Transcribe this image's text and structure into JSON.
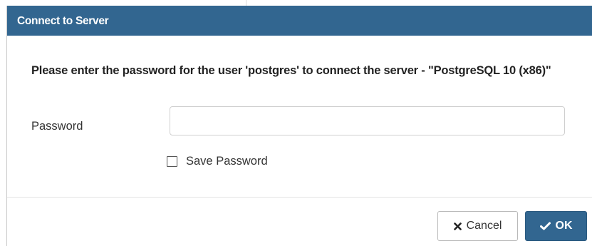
{
  "dialog": {
    "title": "Connect to Server",
    "message": "Please enter the password for the user 'postgres' to connect the server - \"PostgreSQL 10 (x86)\"",
    "password": {
      "label": "Password",
      "value": "",
      "placeholder": ""
    },
    "save_password": {
      "label": "Save Password",
      "checked": false
    },
    "buttons": {
      "cancel": {
        "label": "Cancel",
        "icon": "close-icon"
      },
      "ok": {
        "label": "OK",
        "icon": "checkmark-icon"
      }
    },
    "colors": {
      "header": "#326690",
      "primary_button": "#326690"
    }
  }
}
